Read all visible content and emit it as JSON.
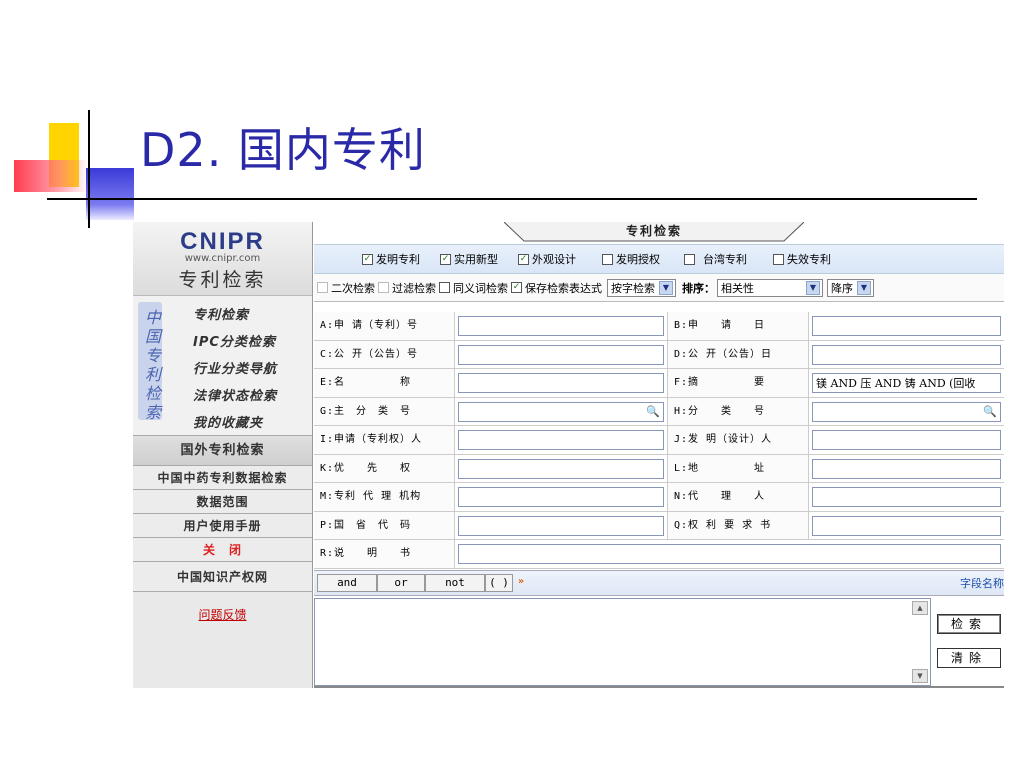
{
  "slide": {
    "title": "D2. 国内专利"
  },
  "sidebar": {
    "logo_main": "CNIPR",
    "logo_url": "www.cnipr.com",
    "logo_sub": "专利检索",
    "vertical_label": [
      "中",
      "国",
      "专",
      "利",
      "检",
      "索"
    ],
    "cn_menu": [
      "专利检索",
      "IPC分类检索",
      "行业分类导航",
      "法律状态检索",
      "我的收藏夹"
    ],
    "foreign": "国外专利检索",
    "links": [
      "中国中药专利数据检索",
      "数据范围",
      "用户使用手册"
    ],
    "close": "关　闭",
    "ip_site": "中国知识产权网",
    "feedback": "问题反馈"
  },
  "main": {
    "tab_title": "专利检索",
    "types": [
      {
        "label": "发明专利",
        "checked": true
      },
      {
        "label": "实用新型",
        "checked": true
      },
      {
        "label": "外观设计",
        "checked": true
      },
      {
        "label": "发明授权",
        "checked": false
      },
      {
        "label": "台湾专利",
        "checked": false
      },
      {
        "label": "失效专利",
        "checked": false
      }
    ],
    "options": [
      {
        "label": "二次检索",
        "checked": false
      },
      {
        "label": "过滤检索",
        "checked": false
      },
      {
        "label": "同义词检索",
        "checked": false
      },
      {
        "label": "保存检索表达式",
        "checked": true
      }
    ],
    "mode_select": "按字检索",
    "sort_label": "排序：",
    "sort_select": "相关性",
    "order_select": "降序",
    "fields": [
      {
        "left_label": "A:申 请（专利）号",
        "left_value": "",
        "right_label": "B:申　　请　　日",
        "right_value": ""
      },
      {
        "left_label": "C:公 开（公告）号",
        "left_value": "",
        "right_label": "D:公 开（公告）日",
        "right_value": ""
      },
      {
        "left_label": "E:名　　　　　称",
        "left_value": "",
        "right_label": "F:摘　　　　　要",
        "right_value": "镁 AND 压 AND 铸 AND (回收"
      },
      {
        "left_label": "G:主　分　类　号",
        "left_value": "",
        "right_label": "H:分　　类　　号",
        "right_value": ""
      },
      {
        "left_label": "I:申请（专利权）人",
        "left_value": "",
        "right_label": "J:发 明（设计）人",
        "right_value": ""
      },
      {
        "left_label": "K:优　　先　　权",
        "left_value": "",
        "right_label": "L:地　　　　　址",
        "right_value": ""
      },
      {
        "left_label": "M:专利 代 理 机构",
        "left_value": "",
        "right_label": "N:代　　理　　人",
        "right_value": ""
      },
      {
        "left_label": "P:国　省　代　码",
        "left_value": "",
        "right_label": "Q:权 利 要 求 书",
        "right_value": ""
      }
    ],
    "last_field": {
      "label": "R:说　　明　　书",
      "value": ""
    },
    "ops": [
      "and",
      "or",
      "not",
      "( )"
    ],
    "ops_more": "»",
    "field_names": "字段名称",
    "search_button": "检索",
    "clear_button": "清除"
  }
}
